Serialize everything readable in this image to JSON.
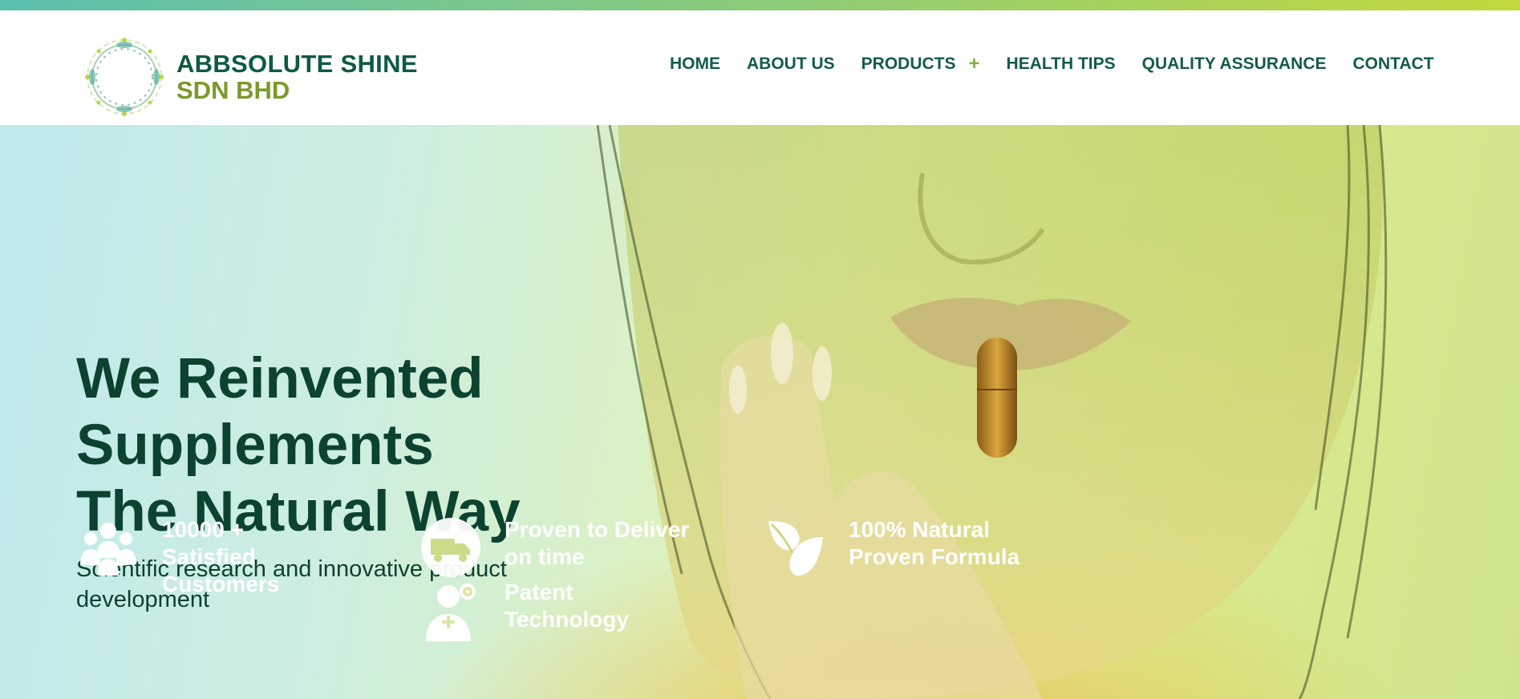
{
  "brand": {
    "line1": "ABBSOLUTE SHINE",
    "line2": "SDN BHD",
    "logo_icon": "circular-leaf-wreath-logo"
  },
  "nav": {
    "items": [
      {
        "label": "HOME"
      },
      {
        "label": "ABOUT US"
      },
      {
        "label": "PRODUCTS",
        "expand_symbol": "+"
      },
      {
        "label": "HEALTH TIPS"
      },
      {
        "label": "QUALITY ASSURANCE"
      },
      {
        "label": "CONTACT"
      }
    ]
  },
  "hero": {
    "headline": [
      "We Reinvented",
      "Supplements",
      "The Natural Way"
    ],
    "subtitle": "Scientific research and innovative product development",
    "background_image": "woman-holding-golden-capsule-to-lips"
  },
  "features": [
    {
      "icon": "people-group-icon",
      "text": "10000 + Satisfied Customers"
    },
    {
      "icon": "delivery-truck-icon",
      "text": "Proven to Deliver on time"
    },
    {
      "icon": "doctor-icon",
      "text": "Patent Technology"
    },
    {
      "icon": "leaf-icon",
      "text": "100% Natural Proven Formula"
    }
  ],
  "colors": {
    "brand_dark_green": "#0d5a43",
    "brand_olive": "#7a9a2a",
    "nav_text": "#135b4c",
    "accent_plus": "#7fb342",
    "headline": "#0c4230"
  }
}
